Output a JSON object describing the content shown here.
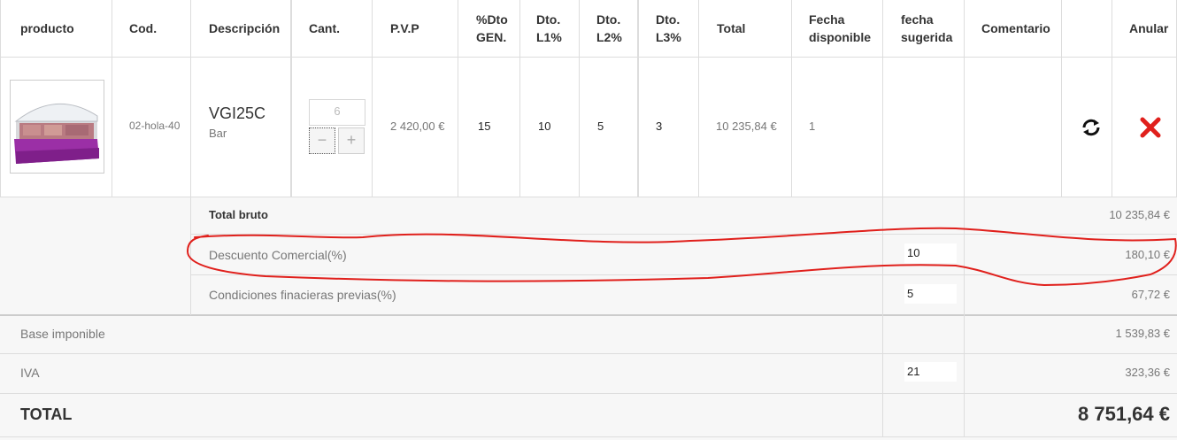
{
  "table": {
    "headers": {
      "producto": "producto",
      "cod": "Cod.",
      "descripcion": "Descripción",
      "cant": "Cant.",
      "pvp": "P.V.P",
      "dto_gen_1": "%Dto",
      "dto_gen_2": "GEN.",
      "dto_l1_1": "Dto.",
      "dto_l1_2": "L1%",
      "dto_l2_1": "Dto.",
      "dto_l2_2": "L2%",
      "dto_l3_1": "Dto.",
      "dto_l3_2": "L3%",
      "total": "Total",
      "fecha_disp_1": "Fecha",
      "fecha_disp_2": "disponible",
      "fecha_sug_1": "fecha",
      "fecha_sug_2": "sugerida",
      "comentario": "Comentario",
      "anular": "Anular"
    },
    "row": {
      "image": "product-display-case-image",
      "cod": "02-hola-40",
      "name": "VGI25C",
      "subname": "Bar",
      "cantidad": "6",
      "pvp": "2 420,00 €",
      "dto_gen": "15",
      "dto_l1": "10",
      "dto_l2": "5",
      "dto_l3": "3",
      "total": "10 235,84 €",
      "fecha_disponible": "1",
      "icons": {
        "refresh": "refresh-icon",
        "delete": "delete-x-icon",
        "minus": "minus-icon",
        "plus": "plus-icon"
      }
    }
  },
  "summary": {
    "total_bruto_label": "Total bruto",
    "total_bruto_value": "10 235,84 €",
    "descuento_label": "Descuento Comercial(%)",
    "descuento_input": "10",
    "descuento_value": "180,10 €",
    "condiciones_label": "Condiciones finacieras previas(%)",
    "condiciones_input": "5",
    "condiciones_value": "67,72 €",
    "base_label": "Base imponible",
    "base_value": "1 539,83 €",
    "iva_label": "IVA",
    "iva_input": "21",
    "iva_value": "323,36 €",
    "total_label": "TOTAL",
    "total_value": "8 751,64 €"
  },
  "colors": {
    "annotation": "#e0201c",
    "delete": "#e0201c",
    "summary_bg": "#f7f7f7"
  }
}
